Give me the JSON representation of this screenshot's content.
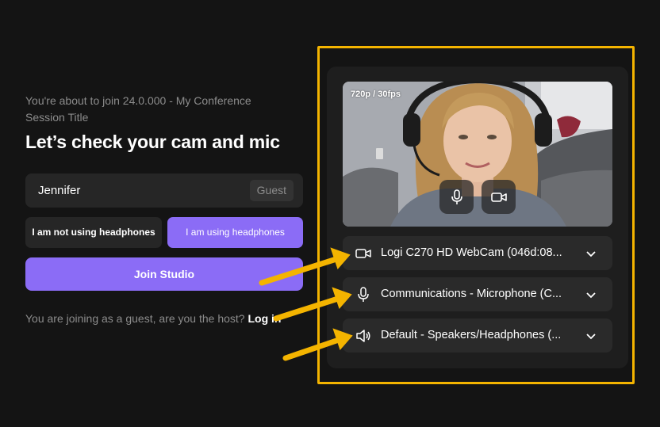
{
  "session": {
    "subtitle": "You're about to join 24.0.000 - My Conference Session Title",
    "heading": "Let’s check your cam and mic"
  },
  "name_field": {
    "value": "Jennifer",
    "badge": "Guest"
  },
  "headphones": {
    "not_using_label": "I am not using headphones",
    "using_label": "I am using headphones",
    "selected": "using"
  },
  "join_button": {
    "label": "Join Studio"
  },
  "guest_prompt": {
    "text": "You are joining as a guest, are you the host? ",
    "login_label": "Log in"
  },
  "video": {
    "resolution": "720p / 30fps",
    "mic_icon": "microphone-icon",
    "cam_icon": "camera-icon"
  },
  "devices": [
    {
      "icon": "camera-icon",
      "label": "Logi C270 HD WebCam (046d:08..."
    },
    {
      "icon": "microphone-icon",
      "label": "Communications - Microphone (C..."
    },
    {
      "icon": "speaker-icon",
      "label": "Default - Speakers/Headphones (..."
    }
  ],
  "colors": {
    "background": "#141414",
    "accent": "#8b6cf6",
    "highlight": "#f4b400",
    "surface": "#262626"
  }
}
